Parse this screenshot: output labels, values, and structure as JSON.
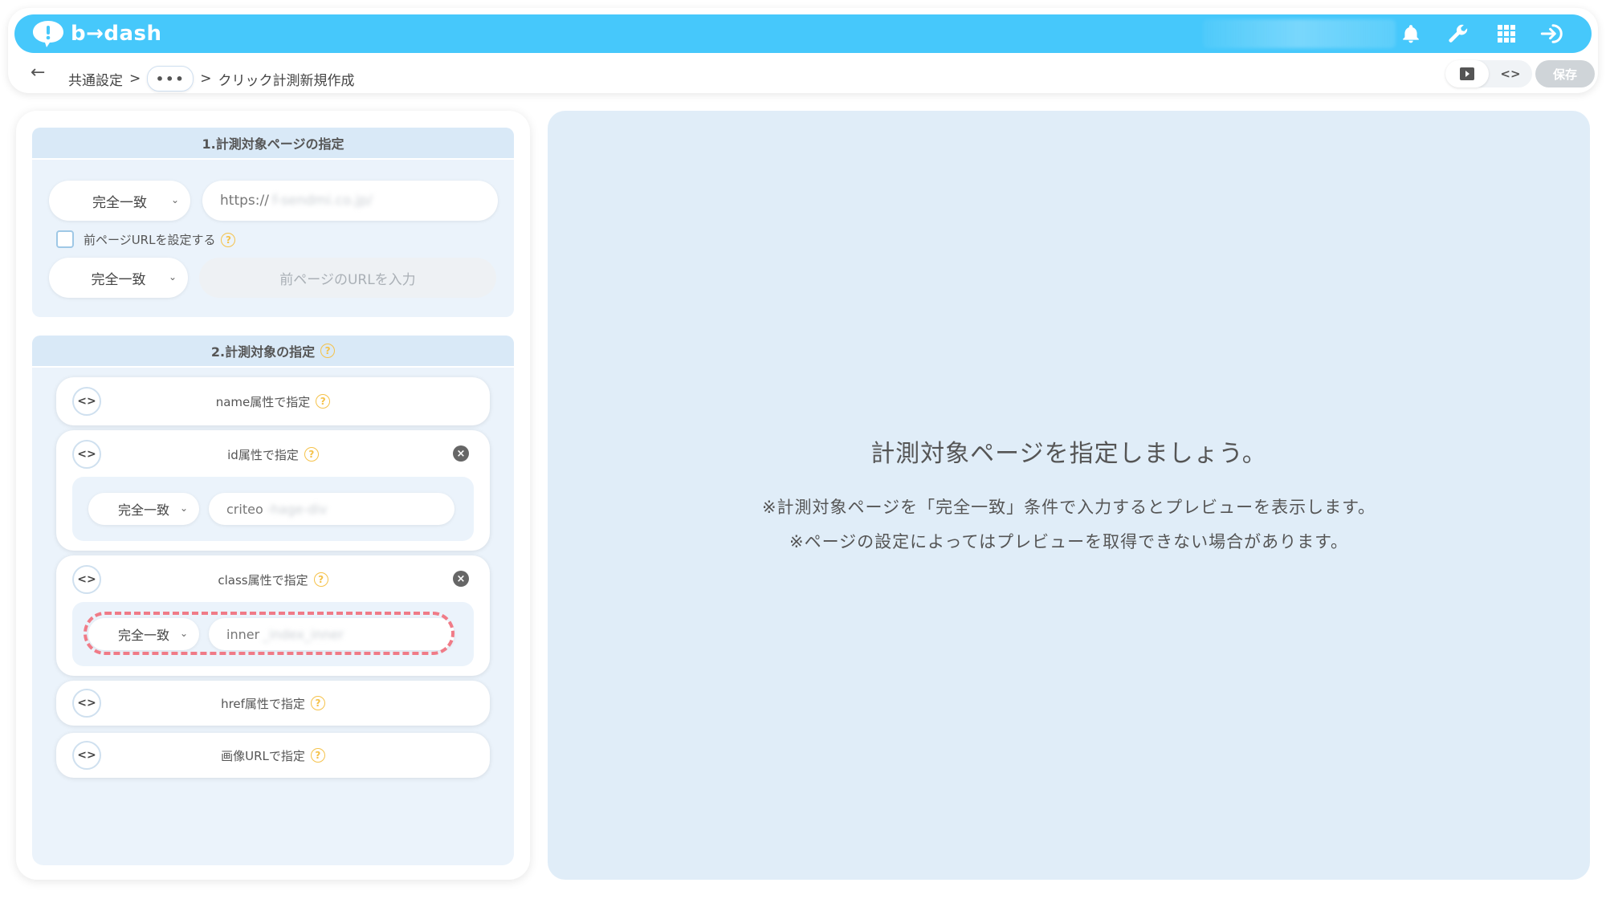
{
  "header": {
    "logo_text": "b→dash",
    "icons": [
      "bell-icon",
      "wrench-icon",
      "apps-grid-icon",
      "logout-icon"
    ]
  },
  "breadcrumb": {
    "back_icon": "←",
    "root": "共通設定",
    "sep": ">",
    "more": "•••",
    "current": "クリック計測新規作成"
  },
  "toolbar": {
    "preview_icon": "play-square-icon",
    "code_icon": "<>",
    "save_label": "保存"
  },
  "section1": {
    "title": "1.計測対象ページの指定",
    "match_type": "完全一致",
    "url_prefix": "https://",
    "url_blurred": "f-sendmi.co.jp/",
    "prev_checkbox_label": "前ページURLを設定する",
    "prev_match_type": "完全一致",
    "prev_url_placeholder": "前ページのURLを入力"
  },
  "section2": {
    "title": "2.計測対象の指定",
    "attrs": [
      {
        "label": "name属性で指定"
      },
      {
        "label": "id属性で指定",
        "match_type": "完全一致",
        "value_prefix": "criteo",
        "value_blurred": "-hage-div"
      },
      {
        "label": "class属性で指定",
        "match_type": "完全一致",
        "value_prefix": "inner",
        "value_blurred": "_index_inner"
      },
      {
        "label": "href属性で指定"
      },
      {
        "label": "画像URLで指定"
      }
    ],
    "code_glyph": "<>",
    "help_glyph": "?",
    "close_glyph": "×",
    "chevron": "⌄"
  },
  "preview": {
    "title": "計測対象ページを指定しましょう。",
    "line1": "※計測対象ページを「完全一致」条件で入力するとプレビューを表示します。",
    "line2": "※ページの設定によってはプレビューを取得できない場合があります。"
  },
  "colors": {
    "brand": "#46c8fb",
    "highlight": "#f07b87",
    "help": "#f5c24a",
    "section_bg": "#ebf3fb",
    "preview_bg": "#e0edf8"
  }
}
